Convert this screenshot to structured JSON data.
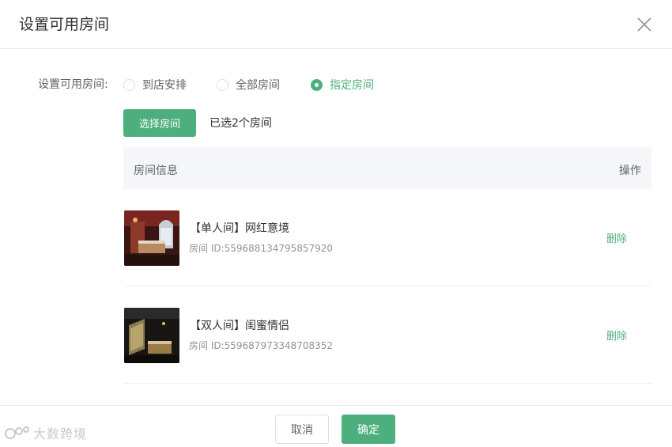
{
  "dialog": {
    "title": "设置可用房间",
    "close_icon": "close-icon"
  },
  "availability": {
    "label": "设置可用房间:",
    "options": [
      {
        "label": "到店安排",
        "checked": false
      },
      {
        "label": "全部房间",
        "checked": false
      },
      {
        "label": "指定房间",
        "checked": true
      }
    ]
  },
  "selection": {
    "button_label": "选择房间",
    "count_text": "已选2个房间"
  },
  "table": {
    "headers": {
      "info": "房间信息",
      "action": "操作"
    },
    "rows": [
      {
        "name": "【单人间】网红意境",
        "id_text": "房间 ID:559688134795857920",
        "action": "删除",
        "thumb": "room-photo-red"
      },
      {
        "name": "【双人间】闺蜜情侣",
        "id_text": "房间 ID:559687973348708352",
        "action": "删除",
        "thumb": "room-photo-dark"
      }
    ]
  },
  "footer": {
    "cancel_label": "取消",
    "confirm_label": "确定"
  },
  "watermark": {
    "text": "大数跨境"
  },
  "colors": {
    "accent": "#4caf7d",
    "header_bg": "#f5f6fa"
  }
}
